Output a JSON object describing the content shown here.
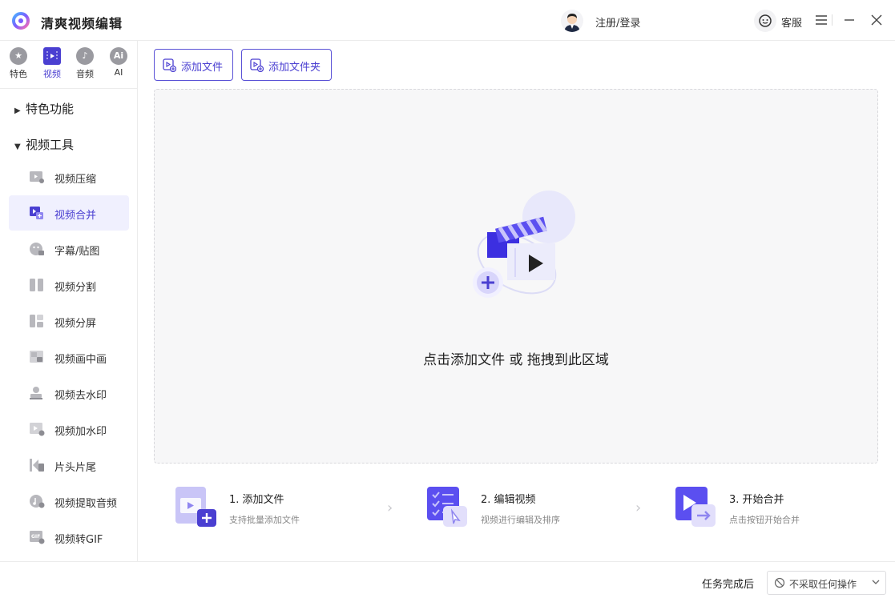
{
  "app": {
    "title": "清爽视频编辑"
  },
  "header": {
    "login_label": "注册/登录",
    "service_label": "客服"
  },
  "sidebar": {
    "categories": [
      {
        "label": "特色",
        "icon": "star-icon"
      },
      {
        "label": "视频",
        "icon": "film-icon"
      },
      {
        "label": "音频",
        "icon": "music-note-icon"
      },
      {
        "label": "AI",
        "icon": "ai-icon",
        "glyph": "Ai"
      }
    ],
    "active_category": "视频",
    "groups": [
      {
        "label": "特色功能",
        "expanded": false
      },
      {
        "label": "视频工具",
        "expanded": true
      }
    ],
    "tools": [
      "视频压缩",
      "视频合并",
      "字幕/贴图",
      "视频分割",
      "视频分屏",
      "视频画中画",
      "视频去水印",
      "视频加水印",
      "片头片尾",
      "视频提取音频",
      "视频转GIF"
    ],
    "active_tool": "视频合并"
  },
  "toolbar": {
    "add_file_label": "添加文件",
    "add_folder_label": "添加文件夹"
  },
  "dropzone": {
    "hint": "点击添加文件 或 拖拽到此区域"
  },
  "steps": [
    {
      "title": "1. 添加文件",
      "desc": "支持批量添加文件"
    },
    {
      "title": "2. 编辑视频",
      "desc": "视频进行编辑及排序"
    },
    {
      "title": "3. 开始合并",
      "desc": "点击按钮开始合并"
    }
  ],
  "footer": {
    "after_label": "任务完成后",
    "after_value": "不采取任何操作"
  },
  "colors": {
    "accent": "#4a3fd1",
    "accent_light": "#f0f0fe",
    "dropzone_bg": "#f7f7f8"
  }
}
